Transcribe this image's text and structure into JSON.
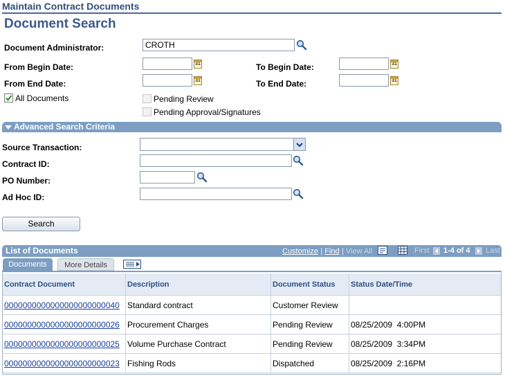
{
  "page": {
    "header": "Maintain Contract Documents",
    "title": "Document Search"
  },
  "search": {
    "admin_label": "Document Administrator:",
    "admin_value": "CROTH",
    "from_begin_label": "From Begin Date:",
    "to_begin_label": "To Begin Date:",
    "from_end_label": "From End Date:",
    "to_end_label": "To End Date:",
    "all_docs_label": "All Documents",
    "pending_review_label": "Pending Review",
    "pending_approval_label": "Pending Approval/Signatures",
    "calendar_glyph": "31"
  },
  "advanced": {
    "title": "Advanced Search Criteria",
    "source_label": "Source Transaction:",
    "contract_label": "Contract ID:",
    "po_label": "PO Number:",
    "adhoc_label": "Ad Hoc ID:",
    "search_button": "Search"
  },
  "grid": {
    "title": "List of Documents",
    "customize": "Customize",
    "find": "Find",
    "view_all": "View All",
    "first": "First",
    "range": "1-4 of 4",
    "last": "Last",
    "tabs": [
      "Documents",
      "More Details"
    ],
    "columns": [
      "Contract Document",
      "Description",
      "Document Status",
      "Status Date/Time"
    ],
    "rows": [
      [
        "0000000000000000000000040",
        "Standard contract",
        "Customer Review",
        ""
      ],
      [
        "0000000000000000000000026",
        "Procurement Charges",
        "Pending Review",
        "08/25/2009  4:00PM"
      ],
      [
        "0000000000000000000000025",
        "Volume Purchase Contract",
        "Pending Review",
        "08/25/2009  3:34PM"
      ],
      [
        "0000000000000000000000023",
        "Fishing Rods",
        "Dispatched",
        "08/25/2009  2:16PM"
      ]
    ]
  },
  "colors": {
    "accent": "#7d9ec2",
    "title": "#3a5a8c",
    "link": "#1a3f9c"
  },
  "icons": [
    "lookup-icon",
    "calendar-icon",
    "checkbox-icon",
    "dropdown-arrow-icon",
    "collapse-arrow-icon",
    "download-icon",
    "grid-icon",
    "prev-arrow-icon",
    "next-arrow-icon",
    "show-all-columns-icon"
  ]
}
